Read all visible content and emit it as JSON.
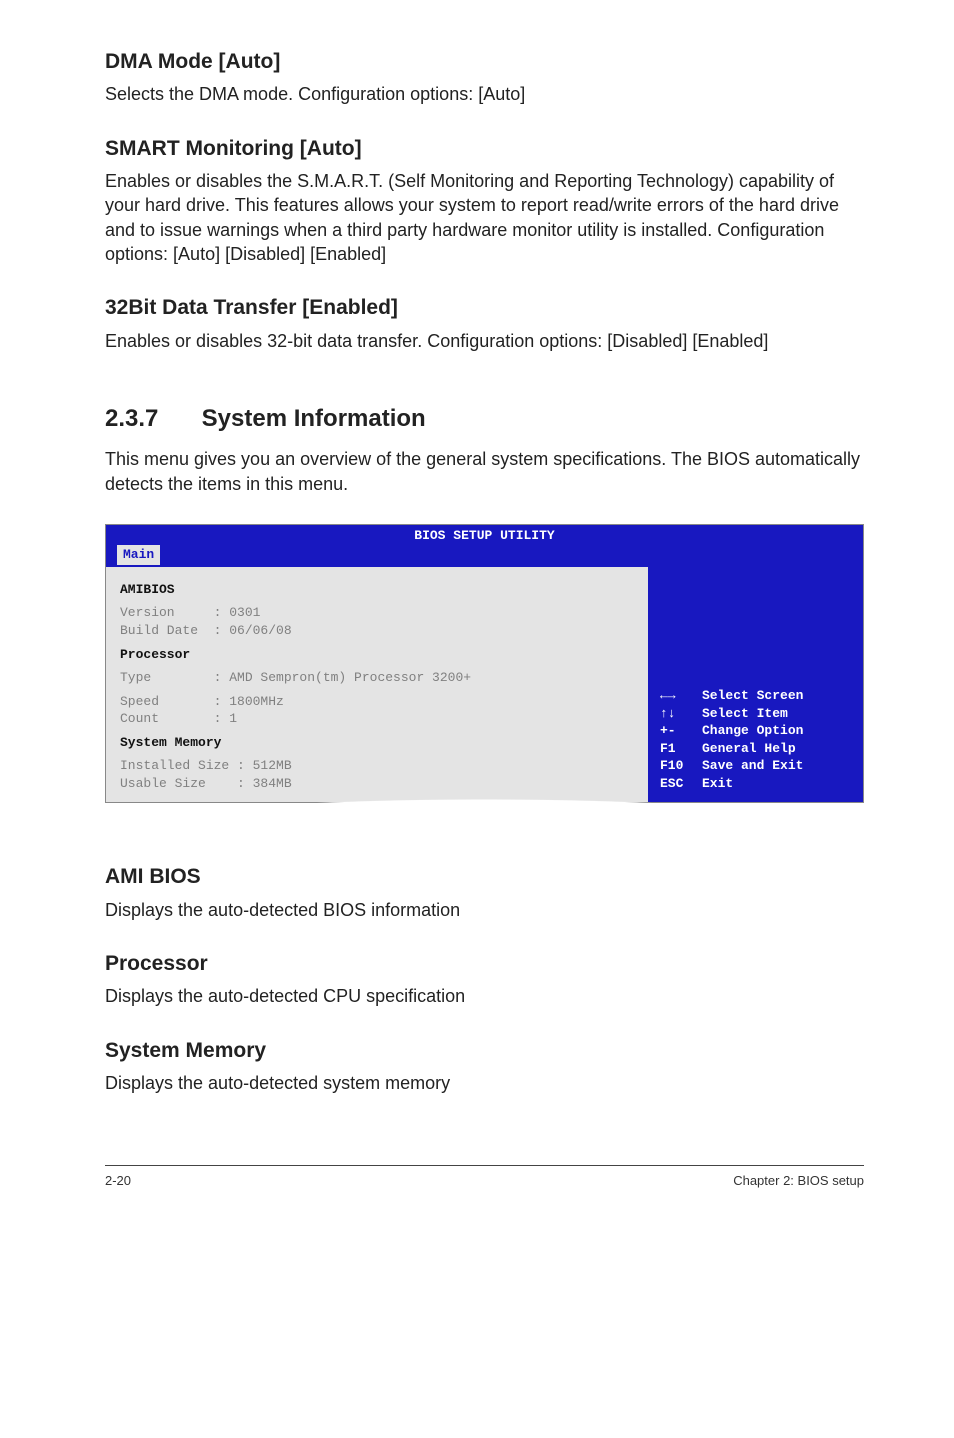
{
  "sections": {
    "dma_heading": "DMA Mode [Auto]",
    "dma_body": "Selects the DMA mode. Configuration options: [Auto]",
    "smart_heading": "SMART Monitoring [Auto]",
    "smart_body": "Enables or disables the S.M.A.R.T. (Self Monitoring and Reporting Technology) capability of your hard drive. This features allows your system to report read/write errors of the hard drive and to issue warnings when a third party hardware monitor utility is installed. Configuration options: [Auto] [Disabled] [Enabled]",
    "bit32_heading": "32Bit Data Transfer [Enabled]",
    "bit32_body": "Enables or disables 32-bit data transfer. Configuration options: [Disabled] [Enabled]",
    "sysinfo_num": "2.3.7",
    "sysinfo_title": "System Information",
    "sysinfo_intro": "This menu gives you an overview of the general system specifications. The BIOS automatically detects the items in this menu.",
    "amibios_heading": "AMI BIOS",
    "amibios_body": "Displays the auto-detected BIOS information",
    "proc_heading": "Processor",
    "proc_body": "Displays the auto-detected CPU specification",
    "mem_heading": "System Memory",
    "mem_body": "Displays the auto-detected system memory"
  },
  "bios": {
    "title": "BIOS SETUP UTILITY",
    "tab": "Main",
    "left": {
      "amibios": "AMIBIOS",
      "version": "Version     : 0301",
      "build": "Build Date  : 06/06/08",
      "processor_hdr": "Processor",
      "type": "Type        : AMD Sempron(tm) Processor 3200+",
      "speed": "Speed       : 1800MHz",
      "count": "Count       : 1",
      "sysmem_hdr": "System Memory",
      "installed": "Installed Size : 512MB",
      "usable": "Usable Size    : 384MB"
    },
    "help": {
      "r1": {
        "k": "←→",
        "t": "Select Screen"
      },
      "r2": {
        "k": "↑↓",
        "t": "Select Item"
      },
      "r3": {
        "k": "+-",
        "t": "Change Option"
      },
      "r4": {
        "k": "F1",
        "t": "General Help"
      },
      "r5": {
        "k": "F10",
        "t": "Save and Exit"
      },
      "r6": {
        "k": "ESC",
        "t": "Exit"
      }
    }
  },
  "footer": {
    "left": "2-20",
    "right": "Chapter 2: BIOS setup"
  }
}
